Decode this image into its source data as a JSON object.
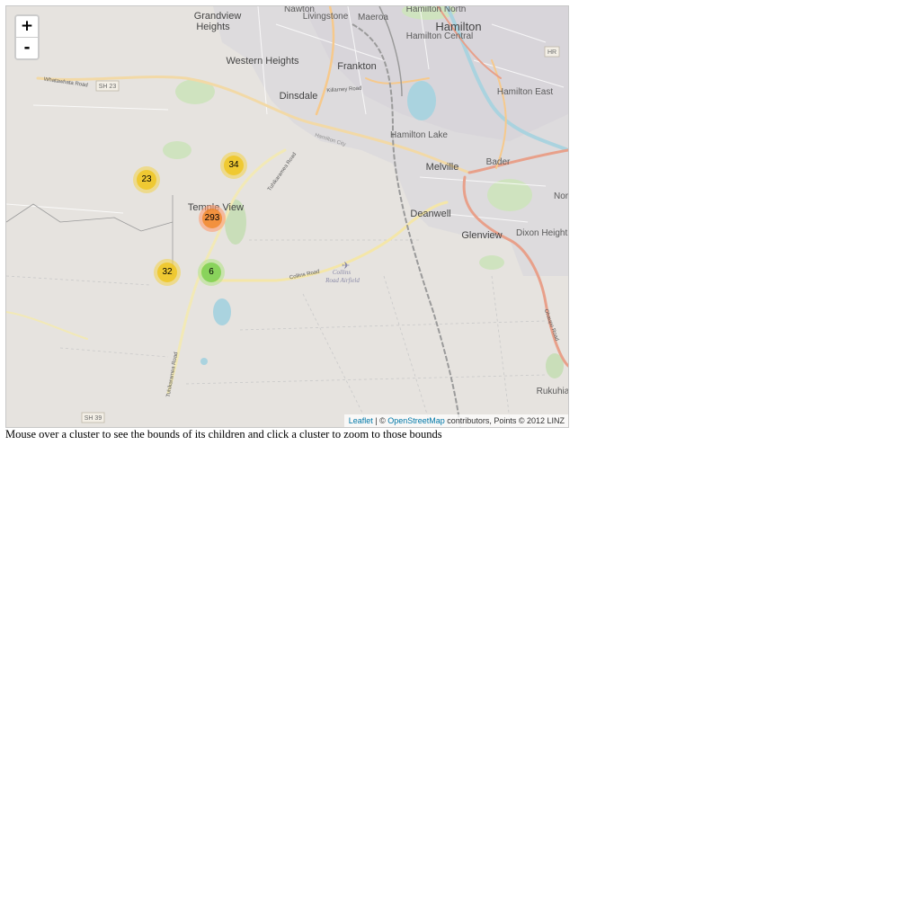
{
  "map": {
    "zoom_in_label": "+",
    "zoom_out_label": "-",
    "place_labels": {
      "grandview_heights": [
        "Grandview",
        "Heights"
      ],
      "nawton": "Nawton",
      "livingstone": "Livingstone",
      "maeroa": "Maeroa",
      "hamilton_north": "Hamilton North",
      "hamilton_central": "Hamilton Central",
      "hamilton": "Hamilton",
      "western_heights": "Western Heights",
      "frankton": "Frankton",
      "dinsdale": "Dinsdale",
      "killarney_road": "Killarney Road",
      "hamilton_east": "Hamilton East",
      "hamilton_lake": "Hamilton Lake",
      "melville": "Melville",
      "bader": "Bader",
      "nor": "Nor",
      "temple_view": "Temple View",
      "deanwell": "Deanwell",
      "glenview": "Glenview",
      "dixon_heights": "Dixon Height",
      "collins_road": "Collins Road",
      "collins_road_airfield": [
        "Collins",
        "Road Airfield"
      ],
      "tuhikaramea_road": "Tuhikaramea Road",
      "whatawhata_road": "Whatawhata Road",
      "ohaupo_road": "Ohaupo Road",
      "rukuhia": "Rukuhia",
      "hamilton_city": "Hamilton City"
    },
    "road_shields": {
      "sh23": "SH 23",
      "sh39": "SH 39",
      "hr": "HR"
    },
    "clusters": [
      {
        "id": "cluster-23",
        "count": "23",
        "size": "medium"
      },
      {
        "id": "cluster-34",
        "count": "34",
        "size": "medium"
      },
      {
        "id": "cluster-293",
        "count": "293",
        "size": "large"
      },
      {
        "id": "cluster-32",
        "count": "32",
        "size": "medium"
      },
      {
        "id": "cluster-6",
        "count": "6",
        "size": "small"
      }
    ],
    "attribution": {
      "leaflet": "Leaflet",
      "separator": " | © ",
      "osm": "OpenStreetMap",
      "rest": " contributors, Points © 2012 LINZ"
    },
    "colors": {
      "land": "#e6e3df",
      "urban": "#dedbe2",
      "major_road": "#f6c98c",
      "motorway": "#e8a08a",
      "water": "#aad3df",
      "park": "#c8e3b4",
      "rail": "#9a9a9a"
    }
  },
  "caption": "Mouse over a cluster to see the bounds of its children and click a cluster to zoom to those bounds"
}
